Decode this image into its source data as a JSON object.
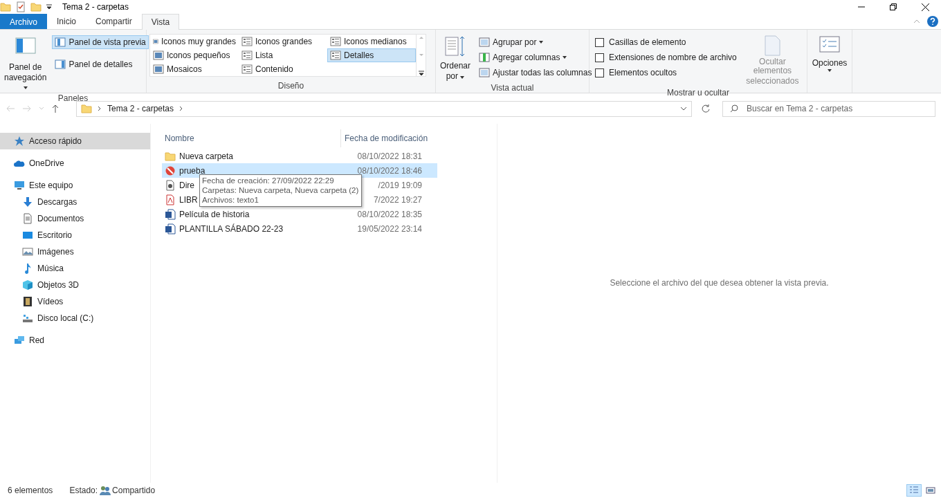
{
  "title_bar": {
    "title": "Tema 2 - carpetas"
  },
  "tabs": [
    {
      "label": "Archivo",
      "kind": "file",
      "selected": false
    },
    {
      "label": "Inicio",
      "kind": "tab",
      "selected": false
    },
    {
      "label": "Compartir",
      "kind": "tab",
      "selected": false
    },
    {
      "label": "Vista",
      "kind": "tab",
      "selected": true
    }
  ],
  "ribbon": {
    "panes": {
      "label": "Paneles",
      "nav_pane": {
        "line1": "Panel de",
        "line2": "navegación"
      },
      "items": [
        {
          "label": "Panel de vista previa",
          "selected": true
        },
        {
          "label": "Panel de detalles",
          "selected": false
        }
      ]
    },
    "layout": {
      "label": "Diseño",
      "items": [
        {
          "label": "Iconos muy grandes",
          "selected": false
        },
        {
          "label": "Iconos grandes",
          "selected": false
        },
        {
          "label": "Iconos medianos",
          "selected": false
        },
        {
          "label": "Iconos pequeños",
          "selected": false
        },
        {
          "label": "Lista",
          "selected": false
        },
        {
          "label": "Detalles",
          "selected": true
        },
        {
          "label": "Mosaicos",
          "selected": false
        },
        {
          "label": "Contenido",
          "selected": false
        }
      ]
    },
    "current_view": {
      "label": "Vista actual",
      "sort": {
        "line1": "Ordenar",
        "line2": "por"
      },
      "items": [
        {
          "label": "Agrupar por",
          "dropdown": true
        },
        {
          "label": "Agregar columnas",
          "dropdown": true
        },
        {
          "label": "Ajustar todas las columnas",
          "dropdown": false
        }
      ]
    },
    "show_hide": {
      "label": "Mostrar u ocultar",
      "checkboxes": [
        {
          "label": "Casillas de elemento",
          "checked": false
        },
        {
          "label": "Extensiones de nombre de archivo",
          "checked": false
        },
        {
          "label": "Elementos ocultos",
          "checked": false
        }
      ],
      "hide_selected": {
        "line1": "Ocultar elementos",
        "line2": "seleccionados",
        "disabled": true
      }
    },
    "options": {
      "label": "Opciones"
    }
  },
  "address_bar": {
    "path": "Tema 2 - carpetas",
    "search_placeholder": "Buscar en Tema 2 - carpetas"
  },
  "sidebar": {
    "items": [
      {
        "label": "Acceso rápido",
        "kind": "star",
        "selected": true
      },
      {
        "label": "OneDrive",
        "kind": "cloud",
        "selected": false
      },
      {
        "label": "Este equipo",
        "kind": "pc",
        "selected": false,
        "children": [
          {
            "label": "Descargas",
            "kind": "download",
            "selected": false
          },
          {
            "label": "Documentos",
            "kind": "document",
            "selected": false
          },
          {
            "label": "Escritorio",
            "kind": "desktop",
            "selected": false
          },
          {
            "label": "Imágenes",
            "kind": "image",
            "selected": false
          },
          {
            "label": "Música",
            "kind": "music",
            "selected": false
          },
          {
            "label": "Objetos 3D",
            "kind": "cube",
            "selected": false
          },
          {
            "label": "Vídeos",
            "kind": "video",
            "selected": false
          },
          {
            "label": "Disco local (C:)",
            "kind": "drive",
            "selected": false
          }
        ]
      },
      {
        "label": "Red",
        "kind": "network",
        "selected": false
      }
    ]
  },
  "table": {
    "columns": [
      "Nombre",
      "Fecha de modificación"
    ],
    "rows": [
      {
        "name": "Nueva carpeta",
        "date": "08/10/2022 18:31",
        "kind": "folder",
        "selected": false
      },
      {
        "name": "prueba",
        "date": "08/10/2022 18:46",
        "kind": "blocked",
        "selected": true
      },
      {
        "name": "Dire",
        "date": "/2019 19:09",
        "kind": "media",
        "selected": false
      },
      {
        "name": "LIBR",
        "date": "7/2022 19:27",
        "kind": "pdf",
        "selected": false
      },
      {
        "name": "Película de historia",
        "date": "08/10/2022 18:35",
        "kind": "word",
        "selected": false
      },
      {
        "name": "PLANTILLA SÁBADO 22-23",
        "date": "19/05/2022 23:14",
        "kind": "word",
        "selected": false
      }
    ]
  },
  "tooltip": {
    "lines": [
      "Fecha de creación: 27/09/2022 22:29",
      "Carpetas: Nueva carpeta, Nueva carpeta (2)",
      "Archivos: texto1"
    ]
  },
  "preview": {
    "message": "Seleccione el archivo del que desea obtener la vista previa."
  },
  "status_bar": {
    "count": "6 elementos",
    "state_label": "Estado:",
    "state": "Compartido",
    "views": [
      {
        "kind": "details",
        "selected": true
      },
      {
        "kind": "tiles",
        "selected": false
      }
    ]
  }
}
